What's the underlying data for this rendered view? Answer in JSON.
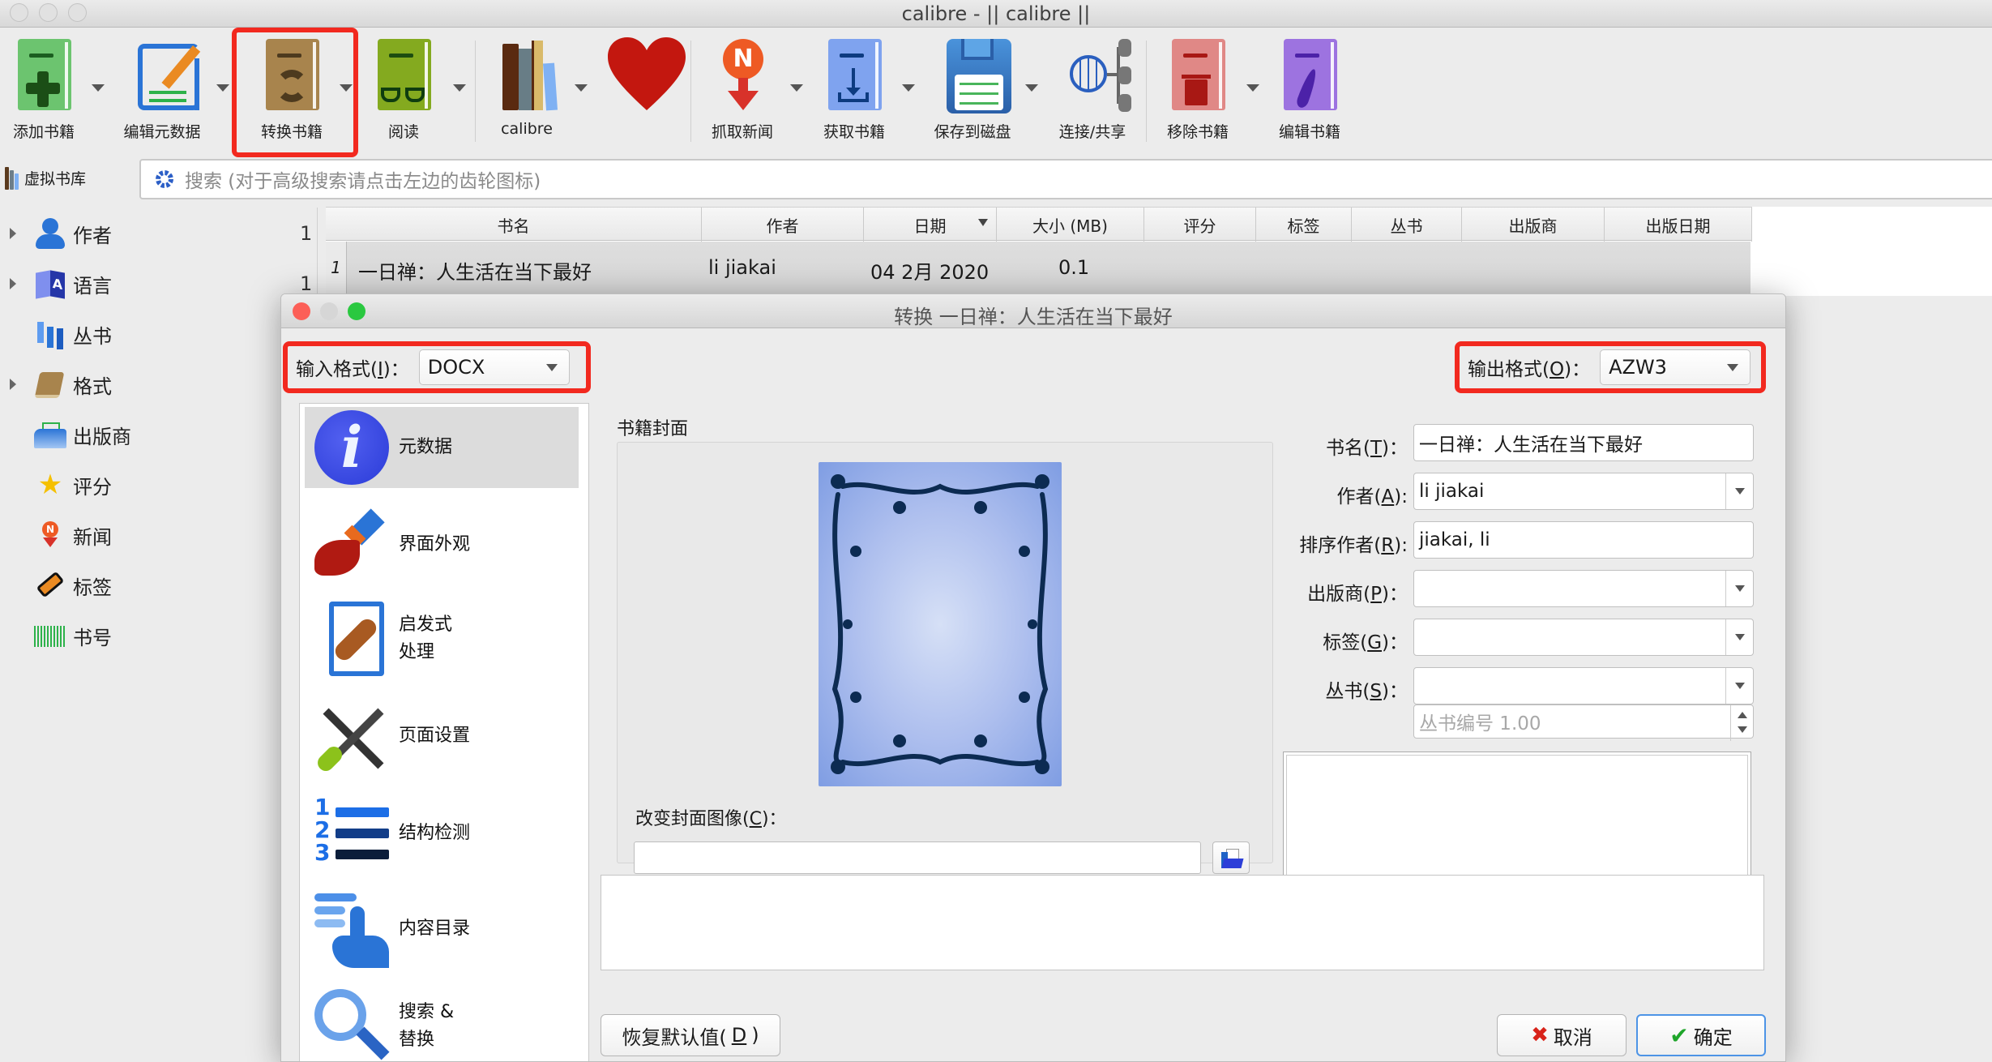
{
  "window": {
    "title": "calibre - || calibre ||"
  },
  "toolbar": {
    "items": [
      {
        "label": "添加书籍",
        "icon": "add-book-icon"
      },
      {
        "label": "编辑元数据",
        "icon": "edit-metadata-icon"
      },
      {
        "label": "转换书籍",
        "icon": "convert-book-icon",
        "highlighted": true
      },
      {
        "label": "阅读",
        "icon": "read-book-icon"
      },
      {
        "label": "calibre",
        "icon": "calibre-library-icon"
      },
      {
        "label": "",
        "icon": "donate-heart-icon"
      },
      {
        "label": "抓取新闻",
        "icon": "fetch-news-icon"
      },
      {
        "label": "获取书籍",
        "icon": "get-books-icon"
      },
      {
        "label": "保存到磁盘",
        "icon": "save-to-disk-icon"
      },
      {
        "label": "连接/共享",
        "icon": "connect-share-icon"
      },
      {
        "label": "移除书籍",
        "icon": "remove-book-icon"
      },
      {
        "label": "编辑书籍",
        "icon": "edit-book-icon"
      }
    ],
    "highlight_color": "#f2291f"
  },
  "virtual_library": {
    "label": "虚拟书库"
  },
  "search": {
    "placeholder": "搜索 (对于高级搜索请点击左边的齿轮图标)"
  },
  "tag_browser": {
    "items": [
      {
        "label": "作者",
        "count": "1",
        "expandable": true
      },
      {
        "label": "语言",
        "count": "1",
        "expandable": true
      },
      {
        "label": "丛书",
        "count": "",
        "expandable": false
      },
      {
        "label": "格式",
        "count": "",
        "expandable": true
      },
      {
        "label": "出版商",
        "count": "",
        "expandable": false
      },
      {
        "label": "评分",
        "count": "",
        "expandable": false
      },
      {
        "label": "新闻",
        "count": "",
        "expandable": false
      },
      {
        "label": "标签",
        "count": "",
        "expandable": false
      },
      {
        "label": "书号",
        "count": "",
        "expandable": false
      }
    ]
  },
  "book_table": {
    "columns": [
      "书名",
      "作者",
      "日期",
      "大小 (MB)",
      "评分",
      "标签",
      "丛书",
      "出版商",
      "出版日期"
    ],
    "sorted_column": "日期",
    "rows": [
      {
        "num": "1",
        "title": "一日禅：人生活在当下最好",
        "author": "li jiakai",
        "date": "04 2月 2020",
        "size": "0.1"
      }
    ]
  },
  "dialog": {
    "title": "转换 一日禅：人生活在当下最好",
    "input_format": {
      "label_pre": "输入格式(",
      "key": "I",
      "label_post": ")：",
      "value": "DOCX"
    },
    "output_format": {
      "label_pre": "输出格式(",
      "key": "O",
      "label_post": ")：",
      "value": "AZW3"
    },
    "pages": [
      {
        "label": "元数据",
        "selected": true
      },
      {
        "label": "界面外观"
      },
      {
        "label": "启发式\n处理"
      },
      {
        "label": "页面设置"
      },
      {
        "label": "结构检测"
      },
      {
        "label": "内容目录"
      },
      {
        "label": "搜索 &\n替换"
      }
    ],
    "cover": {
      "section_title": "书籍封面",
      "change_label_pre": "改变封面图像(",
      "change_key": "C",
      "change_label_post": ")：",
      "path_value": ""
    },
    "metadata": {
      "title": {
        "pre": "书名(",
        "key": "T",
        "post": ")：",
        "value": "一日禅：人生活在当下最好"
      },
      "author": {
        "pre": "作者(",
        "key": "A",
        "post": "):",
        "value": "li jiakai"
      },
      "author_sort": {
        "pre": "排序作者(",
        "key": "R",
        "post": "):",
        "value": "jiakai, li"
      },
      "publisher": {
        "pre": "出版商(",
        "key": "P",
        "post": ")：",
        "value": ""
      },
      "tags": {
        "pre": "标签(",
        "key": "G",
        "post": ")：",
        "value": ""
      },
      "series": {
        "pre": "丛书(",
        "key": "S",
        "post": ")：",
        "value": ""
      },
      "series_index": {
        "placeholder": "丛书编号 1.00"
      },
      "comments": ""
    },
    "buttons": {
      "restore_defaults": {
        "pre": "恢复默认值(",
        "key": "D",
        "post": ")"
      },
      "cancel": "取消",
      "ok": "确定"
    }
  }
}
